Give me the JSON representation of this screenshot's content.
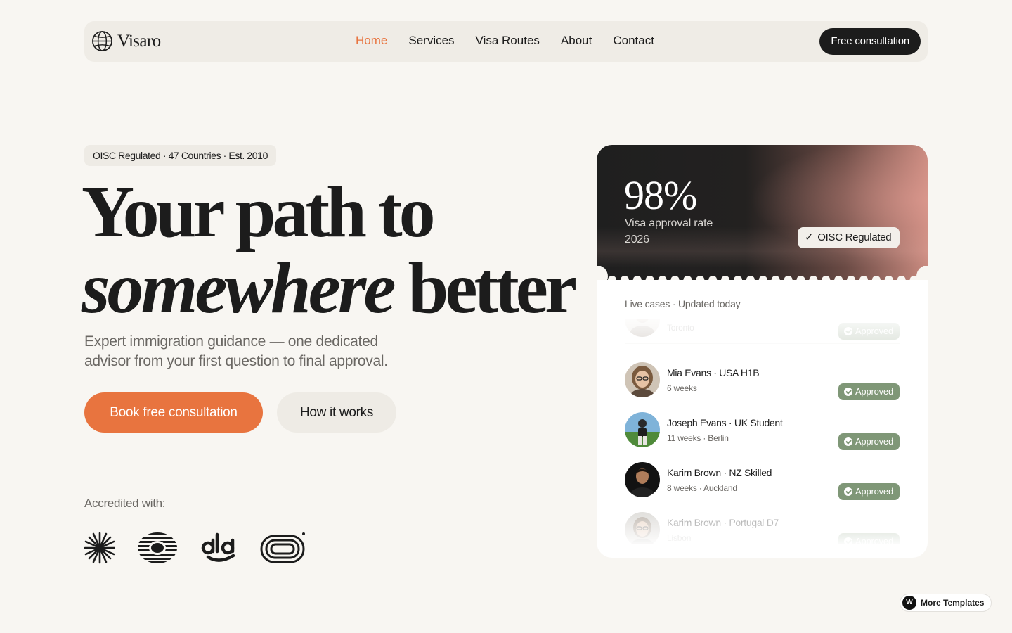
{
  "brand": {
    "name": "Visaro"
  },
  "nav": {
    "links": [
      "Home",
      "Services",
      "Visa Routes",
      "About",
      "Contact"
    ],
    "active": "Home",
    "cta": "Free consultation"
  },
  "hero": {
    "badge": "OISC Regulated · 47 Countries · Est. 2010",
    "headline_line1": "Your path to",
    "headline_italic": "somewhere",
    "headline_rest": "better",
    "subhead": "Expert immigration guidance — one dedicated advisor from your first question to final approval.",
    "primary_cta": "Book free consultation",
    "secondary_cta": "How it works",
    "accredited_label": "Accredited with:"
  },
  "stat": {
    "value": "98%",
    "label": "Visa approval rate 2026",
    "regulated": "OISC Regulated"
  },
  "cases": {
    "title": "Live cases · Updated today",
    "items": [
      {
        "name": "",
        "meta": "Toronto",
        "status": "Approved"
      },
      {
        "name": "Mia Evans · USA H1B",
        "meta": "6 weeks",
        "status": "Approved"
      },
      {
        "name": "Joseph Evans · UK Student",
        "meta": "11 weeks · Berlin",
        "status": "Approved"
      },
      {
        "name": "Karim Brown · NZ Skilled",
        "meta": "8 weeks · Auckland",
        "status": "Approved"
      },
      {
        "name": "Karim Brown · Portugal D7",
        "meta": "Lisbon",
        "status": "Approved"
      }
    ]
  },
  "colors": {
    "accent": "#e8743f",
    "approved": "#7f9777",
    "dark": "#1c1c1c",
    "background": "#f8f6f2"
  },
  "footer_badge": {
    "label": "More Templates"
  }
}
